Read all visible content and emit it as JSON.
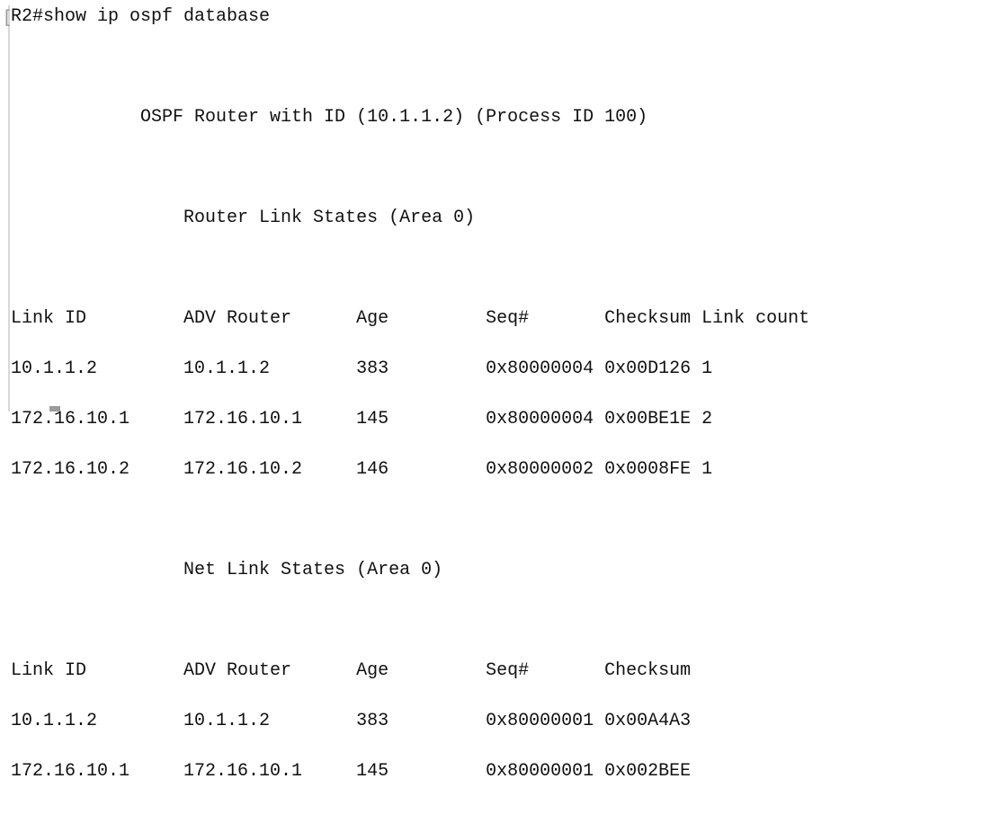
{
  "terminal": {
    "prompt_bracket": "[",
    "lines": [
      "R2#show ip ospf database",
      "",
      "            OSPF Router with ID (10.1.1.2) (Process ID 100)",
      "",
      "                Router Link States (Area 0)",
      "",
      "Link ID         ADV Router      Age         Seq#       Checksum Link count",
      "10.1.1.2        10.1.1.2        383         0x80000004 0x00D126 1",
      "172.16.10.1     172.16.10.1     145         0x80000004 0x00BE1E 2",
      "172.16.10.2     172.16.10.2     146         0x80000002 0x0008FE 1",
      "",
      "                Net Link States (Area 0)",
      "",
      "Link ID         ADV Router      Age         Seq#       Checksum",
      "10.1.1.2        10.1.1.2        383         0x80000001 0x00A4A3",
      "172.16.10.1     172.16.10.1     145         0x80000001 0x002BEE"
    ]
  }
}
